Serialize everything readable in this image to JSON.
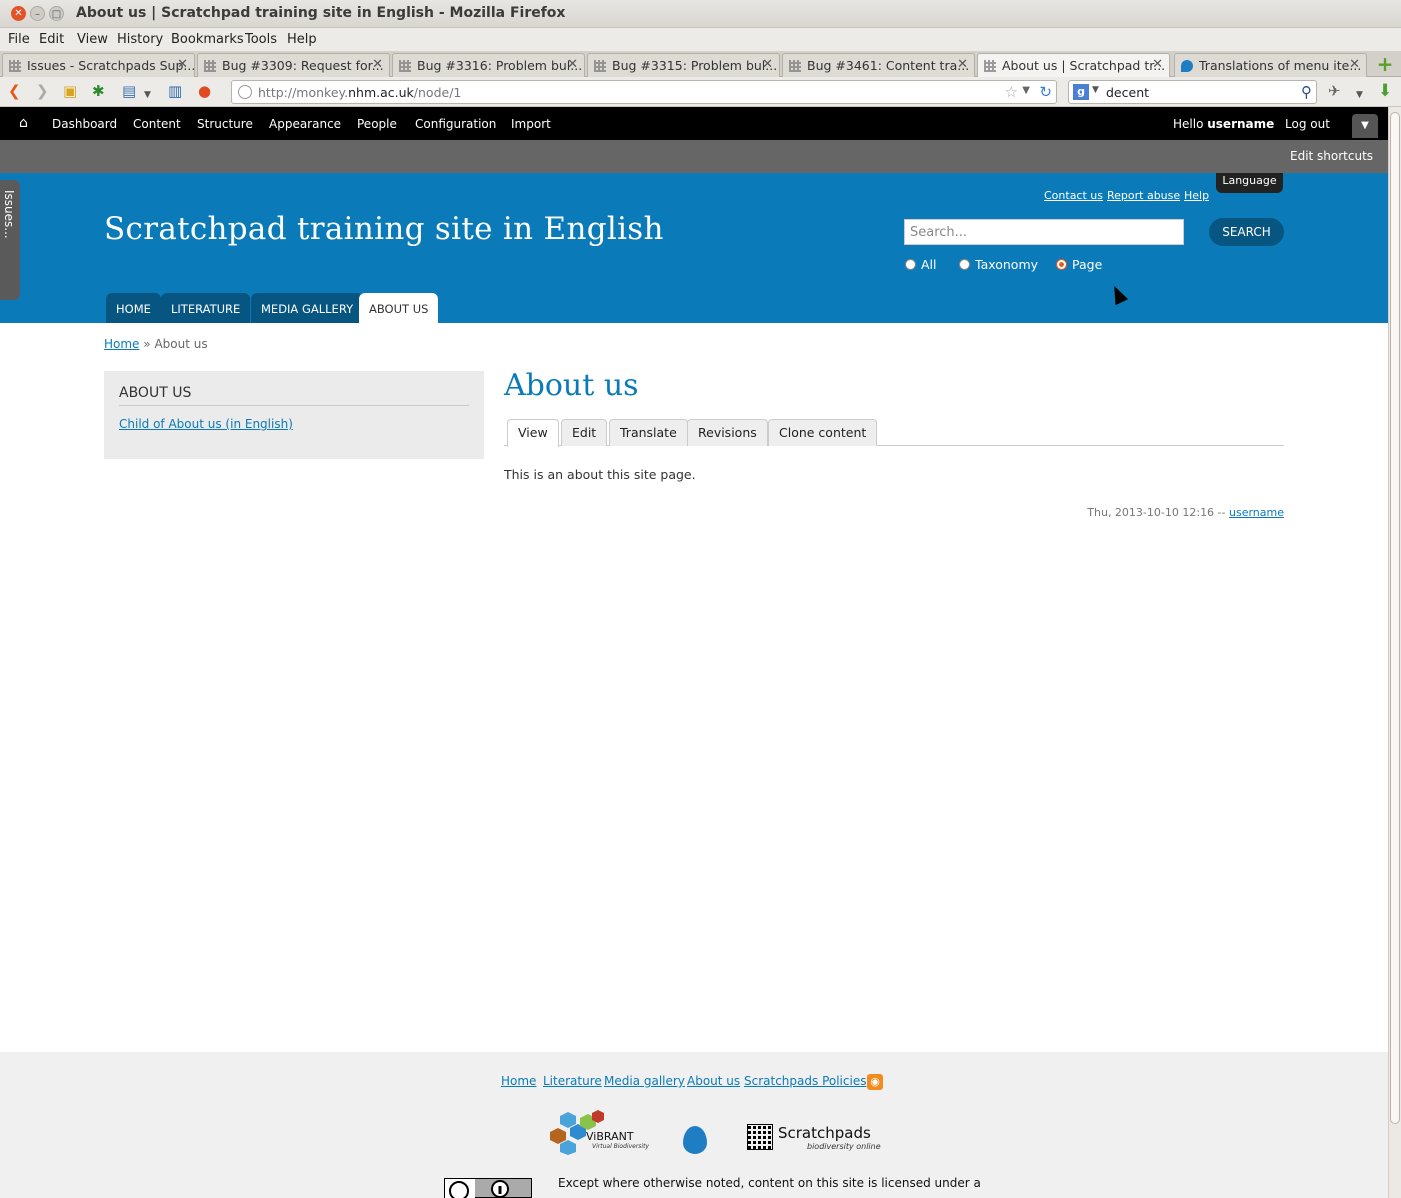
{
  "window": {
    "title": "About us | Scratchpad training site in English - Mozilla Firefox"
  },
  "menubar": [
    "File",
    "Edit",
    "View",
    "History",
    "Bookmarks",
    "Tools",
    "Help"
  ],
  "tabs": [
    {
      "label": "Issues - Scratchpads Sup..."
    },
    {
      "label": "Bug #3309: Request for..."
    },
    {
      "label": "Bug #3316: Problem bul..."
    },
    {
      "label": "Bug #3315: Problem bul..."
    },
    {
      "label": "Bug #3461: Content tra..."
    },
    {
      "label": "About us | Scratchpad tr..."
    },
    {
      "label": "Translations of menu ite..."
    }
  ],
  "navbar": {
    "url_prefix": "http://monkey.",
    "url_domain": "nhm.ac.uk",
    "url_path": "/node/1",
    "search_value": "decent"
  },
  "admin": {
    "items": [
      "Dashboard",
      "Content",
      "Structure",
      "Appearance",
      "People",
      "Configuration",
      "Import"
    ],
    "hello": "Hello",
    "username": "username",
    "logout": "Log out",
    "edit_shortcuts": "Edit shortcuts"
  },
  "header": {
    "site_name": "Scratchpad training site in English",
    "links": [
      "Contact us",
      "Report abuse",
      "Help"
    ],
    "language": "Language",
    "search_placeholder": "Search...",
    "search_button": "SEARCH",
    "radios": [
      "All",
      "Taxonomy",
      "Page"
    ],
    "menu": [
      "HOME",
      "LITERATURE",
      "MEDIA GALLERY",
      "ABOUT US"
    ],
    "issues_tab": "Issues..."
  },
  "breadcrumb": {
    "home": "Home",
    "sep": "»",
    "current": "About us"
  },
  "sidebar": {
    "title": "ABOUT US",
    "link": "Child of About us (in English)"
  },
  "page": {
    "title": "About us",
    "tabs": [
      "View",
      "Edit",
      "Translate",
      "Revisions",
      "Clone content"
    ],
    "body": "This is an about this site page.",
    "meta_date": "Thu, 2013-10-10 12:16 --",
    "meta_user": "username"
  },
  "footer": {
    "links": [
      "Home",
      "Literature",
      "Media gallery",
      "About us",
      "Scratchpads Policies"
    ],
    "vibrant": "ViBRANT",
    "vibrant_tag": "Virtual Biodiversity",
    "scratchpads": "Scratchpads",
    "scratchpads_tag": "biodiversity online",
    "license": "Except where otherwise noted, content on this site is licensed under a"
  }
}
